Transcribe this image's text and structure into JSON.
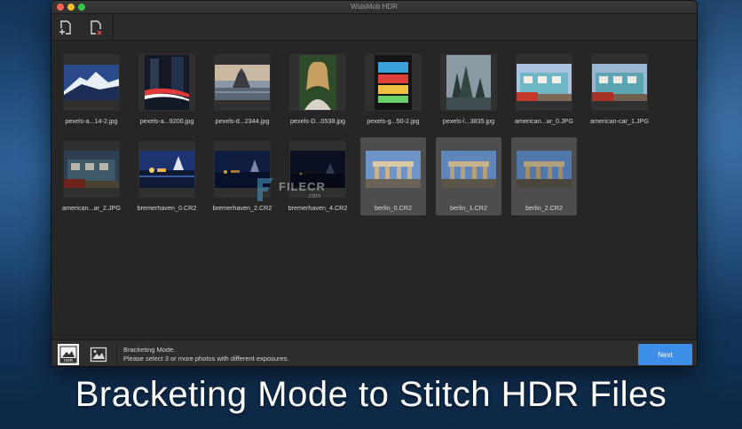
{
  "window": {
    "title": "WidsMob HDR"
  },
  "toolbar": {
    "add_icon": "add-file-icon",
    "remove_icon": "remove-file-icon"
  },
  "thumbnails": [
    {
      "label": "pexels-a...14-2.jpg",
      "selected": false
    },
    {
      "label": "pexels-a...9200.jpg",
      "selected": false
    },
    {
      "label": "pexels-d...2344.jpg",
      "selected": false
    },
    {
      "label": "pexels-D...0538.jpg",
      "selected": false
    },
    {
      "label": "pexels-g...50-2.jpg",
      "selected": false
    },
    {
      "label": "pexels-l...3835.jpg",
      "selected": false
    },
    {
      "label": "american...ar_0.JPG",
      "selected": false
    },
    {
      "label": "american-car_1.JPG",
      "selected": false
    },
    {
      "label": "american...ar_2.JPG",
      "selected": false
    },
    {
      "label": "bremerhaven_0.CR2",
      "selected": false
    },
    {
      "label": "bremerhaven_2.CR2",
      "selected": false
    },
    {
      "label": "bremerhaven_4.CR2",
      "selected": false
    },
    {
      "label": "berlin_0.CR2",
      "selected": true
    },
    {
      "label": "berlin_1.CR2",
      "selected": true
    },
    {
      "label": "berlin_2.CR2",
      "selected": true
    }
  ],
  "watermark": {
    "text": "FILECR",
    "sub": ".com"
  },
  "bottom": {
    "mode_title": "Bracketing Mode.",
    "mode_desc": "Please select 3 or more photos with different exposures.",
    "next_label": "Next",
    "hdr_icon_text": "HDR"
  },
  "caption": "Bracketing Mode to Stitch HDR Files",
  "colors": {
    "accent": "#3d8ee8",
    "window_bg": "#262626",
    "selected_bg": "#4d4d4d"
  }
}
